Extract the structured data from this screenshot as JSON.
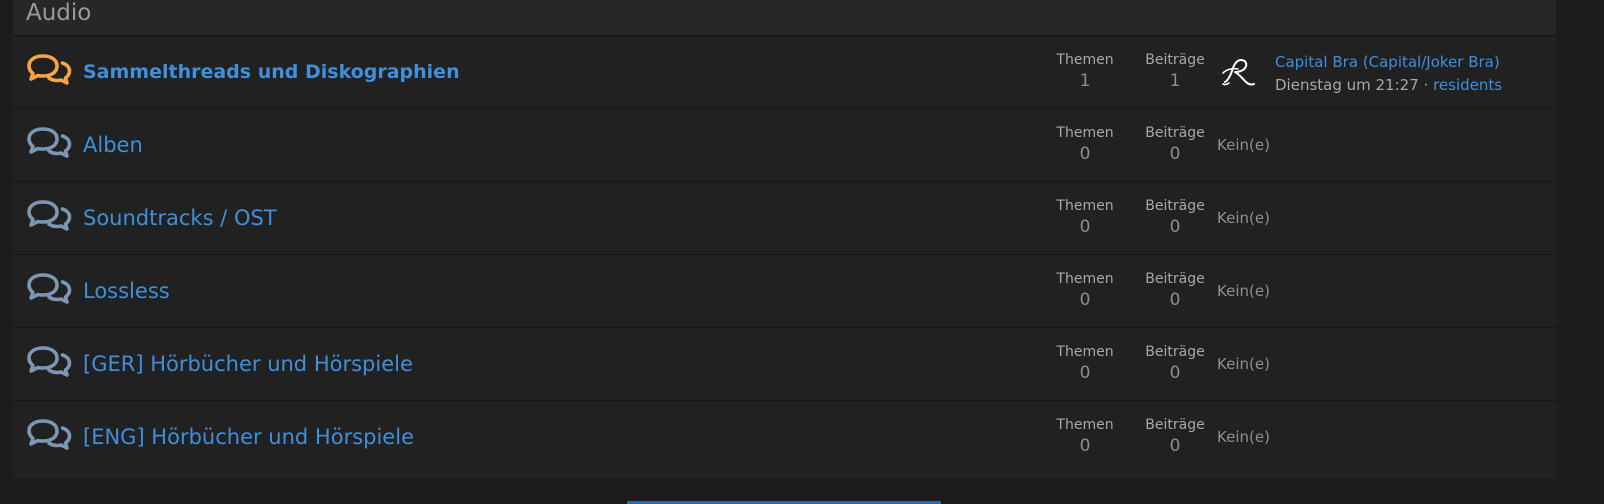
{
  "category": {
    "title": "Audio"
  },
  "nodes": [
    {
      "title": "Sammelthreads und Diskographien",
      "unread": true,
      "icon": "chat-bubbles-icon",
      "themen_label": "Themen",
      "themen_value": "1",
      "beitraege_label": "Beiträge",
      "beitraege_value": "1",
      "latest": {
        "thread": "Capital Bra (Capital/Joker Bra)",
        "date": "Dienstag um 21:27",
        "separator": "·",
        "user": "residents"
      }
    },
    {
      "title": "Alben",
      "unread": false,
      "icon": "chat-bubbles-icon",
      "themen_label": "Themen",
      "themen_value": "0",
      "beitraege_label": "Beiträge",
      "beitraege_value": "0",
      "none_text": "Kein(e)"
    },
    {
      "title": "Soundtracks / OST",
      "unread": false,
      "icon": "chat-bubbles-icon",
      "themen_label": "Themen",
      "themen_value": "0",
      "beitraege_label": "Beiträge",
      "beitraege_value": "0",
      "none_text": "Kein(e)"
    },
    {
      "title": "Lossless",
      "unread": false,
      "icon": "chat-bubbles-icon",
      "themen_label": "Themen",
      "themen_value": "0",
      "beitraege_label": "Beiträge",
      "beitraege_value": "0",
      "none_text": "Kein(e)"
    },
    {
      "title": "[GER] Hörbücher und Hörspiele",
      "unread": false,
      "icon": "chat-bubbles-icon",
      "themen_label": "Themen",
      "themen_value": "0",
      "beitraege_label": "Beiträge",
      "beitraege_value": "0",
      "none_text": "Kein(e)"
    },
    {
      "title": "[ENG] Hörbücher und Hörspiele",
      "unread": false,
      "icon": "chat-bubbles-icon",
      "themen_label": "Themen",
      "themen_value": "0",
      "beitraege_label": "Beiträge",
      "beitraege_value": "0",
      "none_text": "Kein(e)"
    }
  ],
  "colors": {
    "link": "#3f8fdb",
    "icon_unread": "#f5a541",
    "icon_read": "#7c97b3",
    "background": "#1c1c1c"
  }
}
